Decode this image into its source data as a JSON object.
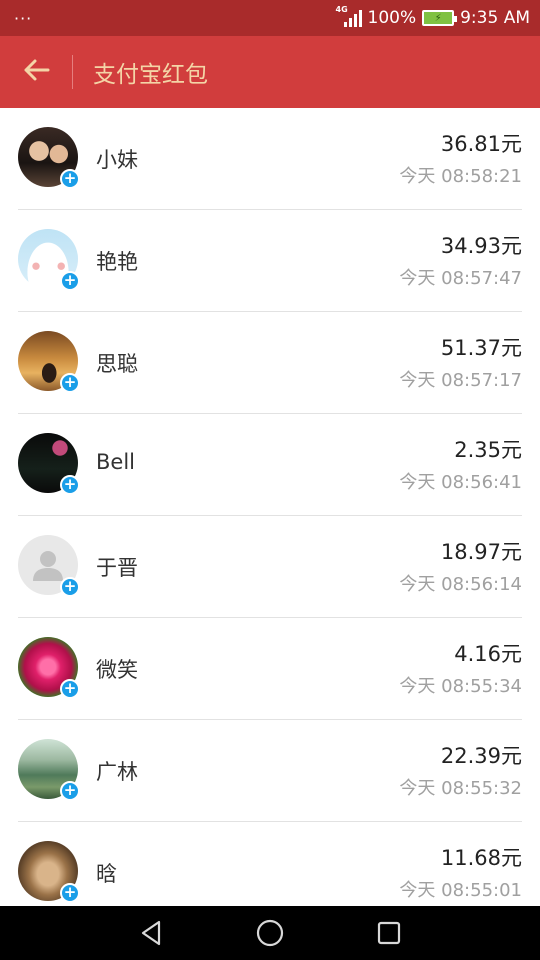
{
  "status_bar": {
    "menu_dots": "···",
    "network": "4G",
    "battery_percent": "100%",
    "time": "9:35 AM",
    "icons": [
      "signal-icon",
      "battery-charging-icon"
    ]
  },
  "header": {
    "back_icon": "arrow-left-icon",
    "title": "支付宝红包"
  },
  "records": [
    {
      "name": "小妹",
      "amount": "36.81元",
      "time": "今天 08:58:21"
    },
    {
      "name": "艳艳",
      "amount": "34.93元",
      "time": "今天 08:57:47"
    },
    {
      "name": "思聪",
      "amount": "51.37元",
      "time": "今天 08:57:17"
    },
    {
      "name": "Bell",
      "amount": "2.35元",
      "time": "今天 08:56:41"
    },
    {
      "name": "于晋",
      "amount": "18.97元",
      "time": "今天 08:56:14"
    },
    {
      "name": "微笑",
      "amount": "4.16元",
      "time": "今天 08:55:34"
    },
    {
      "name": "广林",
      "amount": "22.39元",
      "time": "今天 08:55:32"
    },
    {
      "name": "晗",
      "amount": "11.68元",
      "time": "今天 08:55:01"
    }
  ],
  "nav_bar": {
    "icons": [
      "nav-back-icon",
      "nav-home-icon",
      "nav-recents-icon"
    ]
  }
}
